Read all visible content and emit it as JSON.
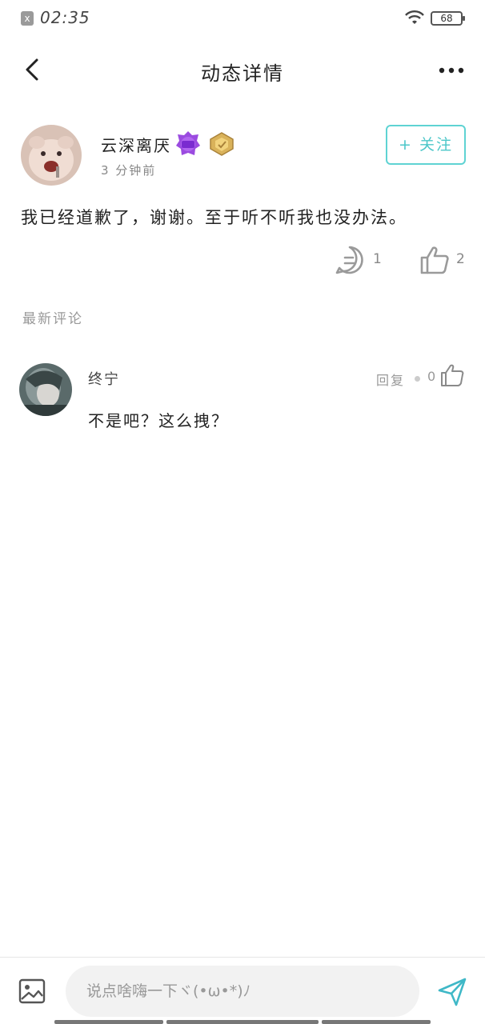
{
  "status_bar": {
    "time": "02:35",
    "battery": "68",
    "notif_icon": "x"
  },
  "header": {
    "title": "动态详情",
    "back_icon": "chevron-left-icon",
    "more_icon": "more-dots-icon"
  },
  "post": {
    "username": "云深离厌",
    "badge_text": "神豪\n情侣",
    "time": "3 分钟前",
    "follow_label": "+ 关注",
    "content": "我已经道歉了，谢谢。至于听不听我也没办法。",
    "comment_count": "1",
    "like_count": "2"
  },
  "comments_section": {
    "label": "最新评论"
  },
  "comments": [
    {
      "name": "终宁",
      "reply_label": "回复",
      "like_count": "0",
      "text": "不是吧？这么拽？"
    }
  ],
  "bottom_bar": {
    "placeholder": "说点啥嗨一下ヾ(•ω•*)ﾉ"
  },
  "colors": {
    "accent": "#4cc7c9",
    "text_primary": "#222222",
    "text_secondary": "#999999"
  }
}
